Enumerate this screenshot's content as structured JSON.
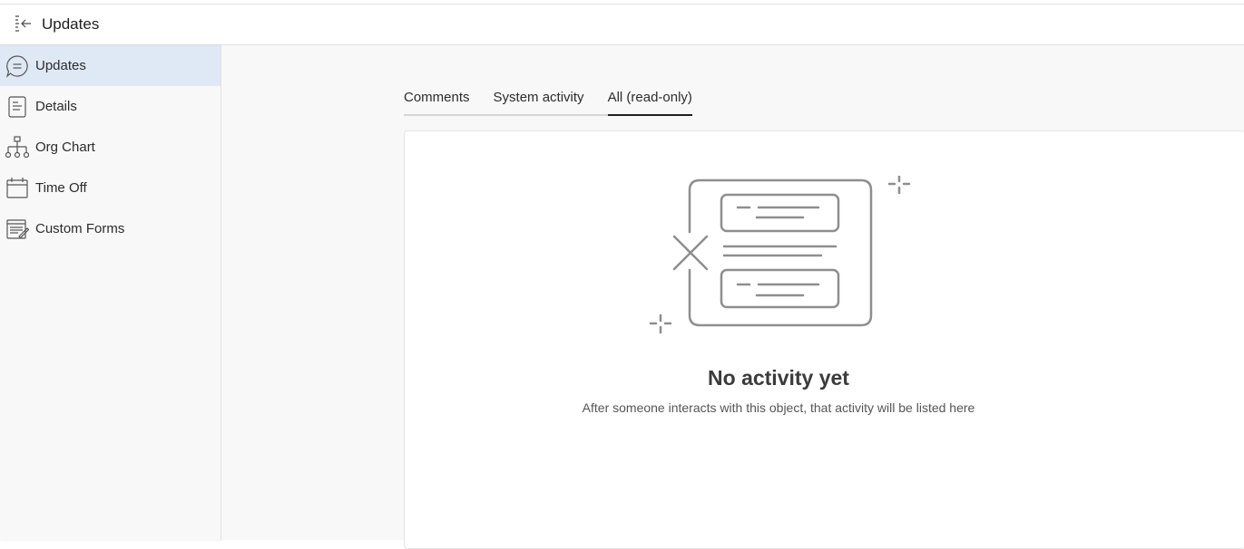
{
  "header": {
    "title": "Updates",
    "collapse_icon": "collapse-panel-icon"
  },
  "sidebar": {
    "items": [
      {
        "label": "Updates",
        "icon": "chat-bubble-icon",
        "active": true
      },
      {
        "label": "Details",
        "icon": "document-icon",
        "active": false
      },
      {
        "label": "Org Chart",
        "icon": "org-chart-icon",
        "active": false
      },
      {
        "label": "Time Off",
        "icon": "calendar-icon",
        "active": false
      },
      {
        "label": "Custom Forms",
        "icon": "forms-icon",
        "active": false
      }
    ]
  },
  "tabs": [
    {
      "label": "Comments",
      "active": false
    },
    {
      "label": "System activity",
      "active": false
    },
    {
      "label": "All (read-only)",
      "active": true
    }
  ],
  "empty_state": {
    "title": "No activity yet",
    "subtitle": "After someone interacts with this object, that activity will be listed here",
    "illustration": "empty-activity-illustration"
  },
  "colors": {
    "active_nav_bg": "#dfe8f5",
    "page_bg": "#f8f8f8",
    "card_bg": "#ffffff",
    "illustration_stroke": "#8e8e8e"
  }
}
